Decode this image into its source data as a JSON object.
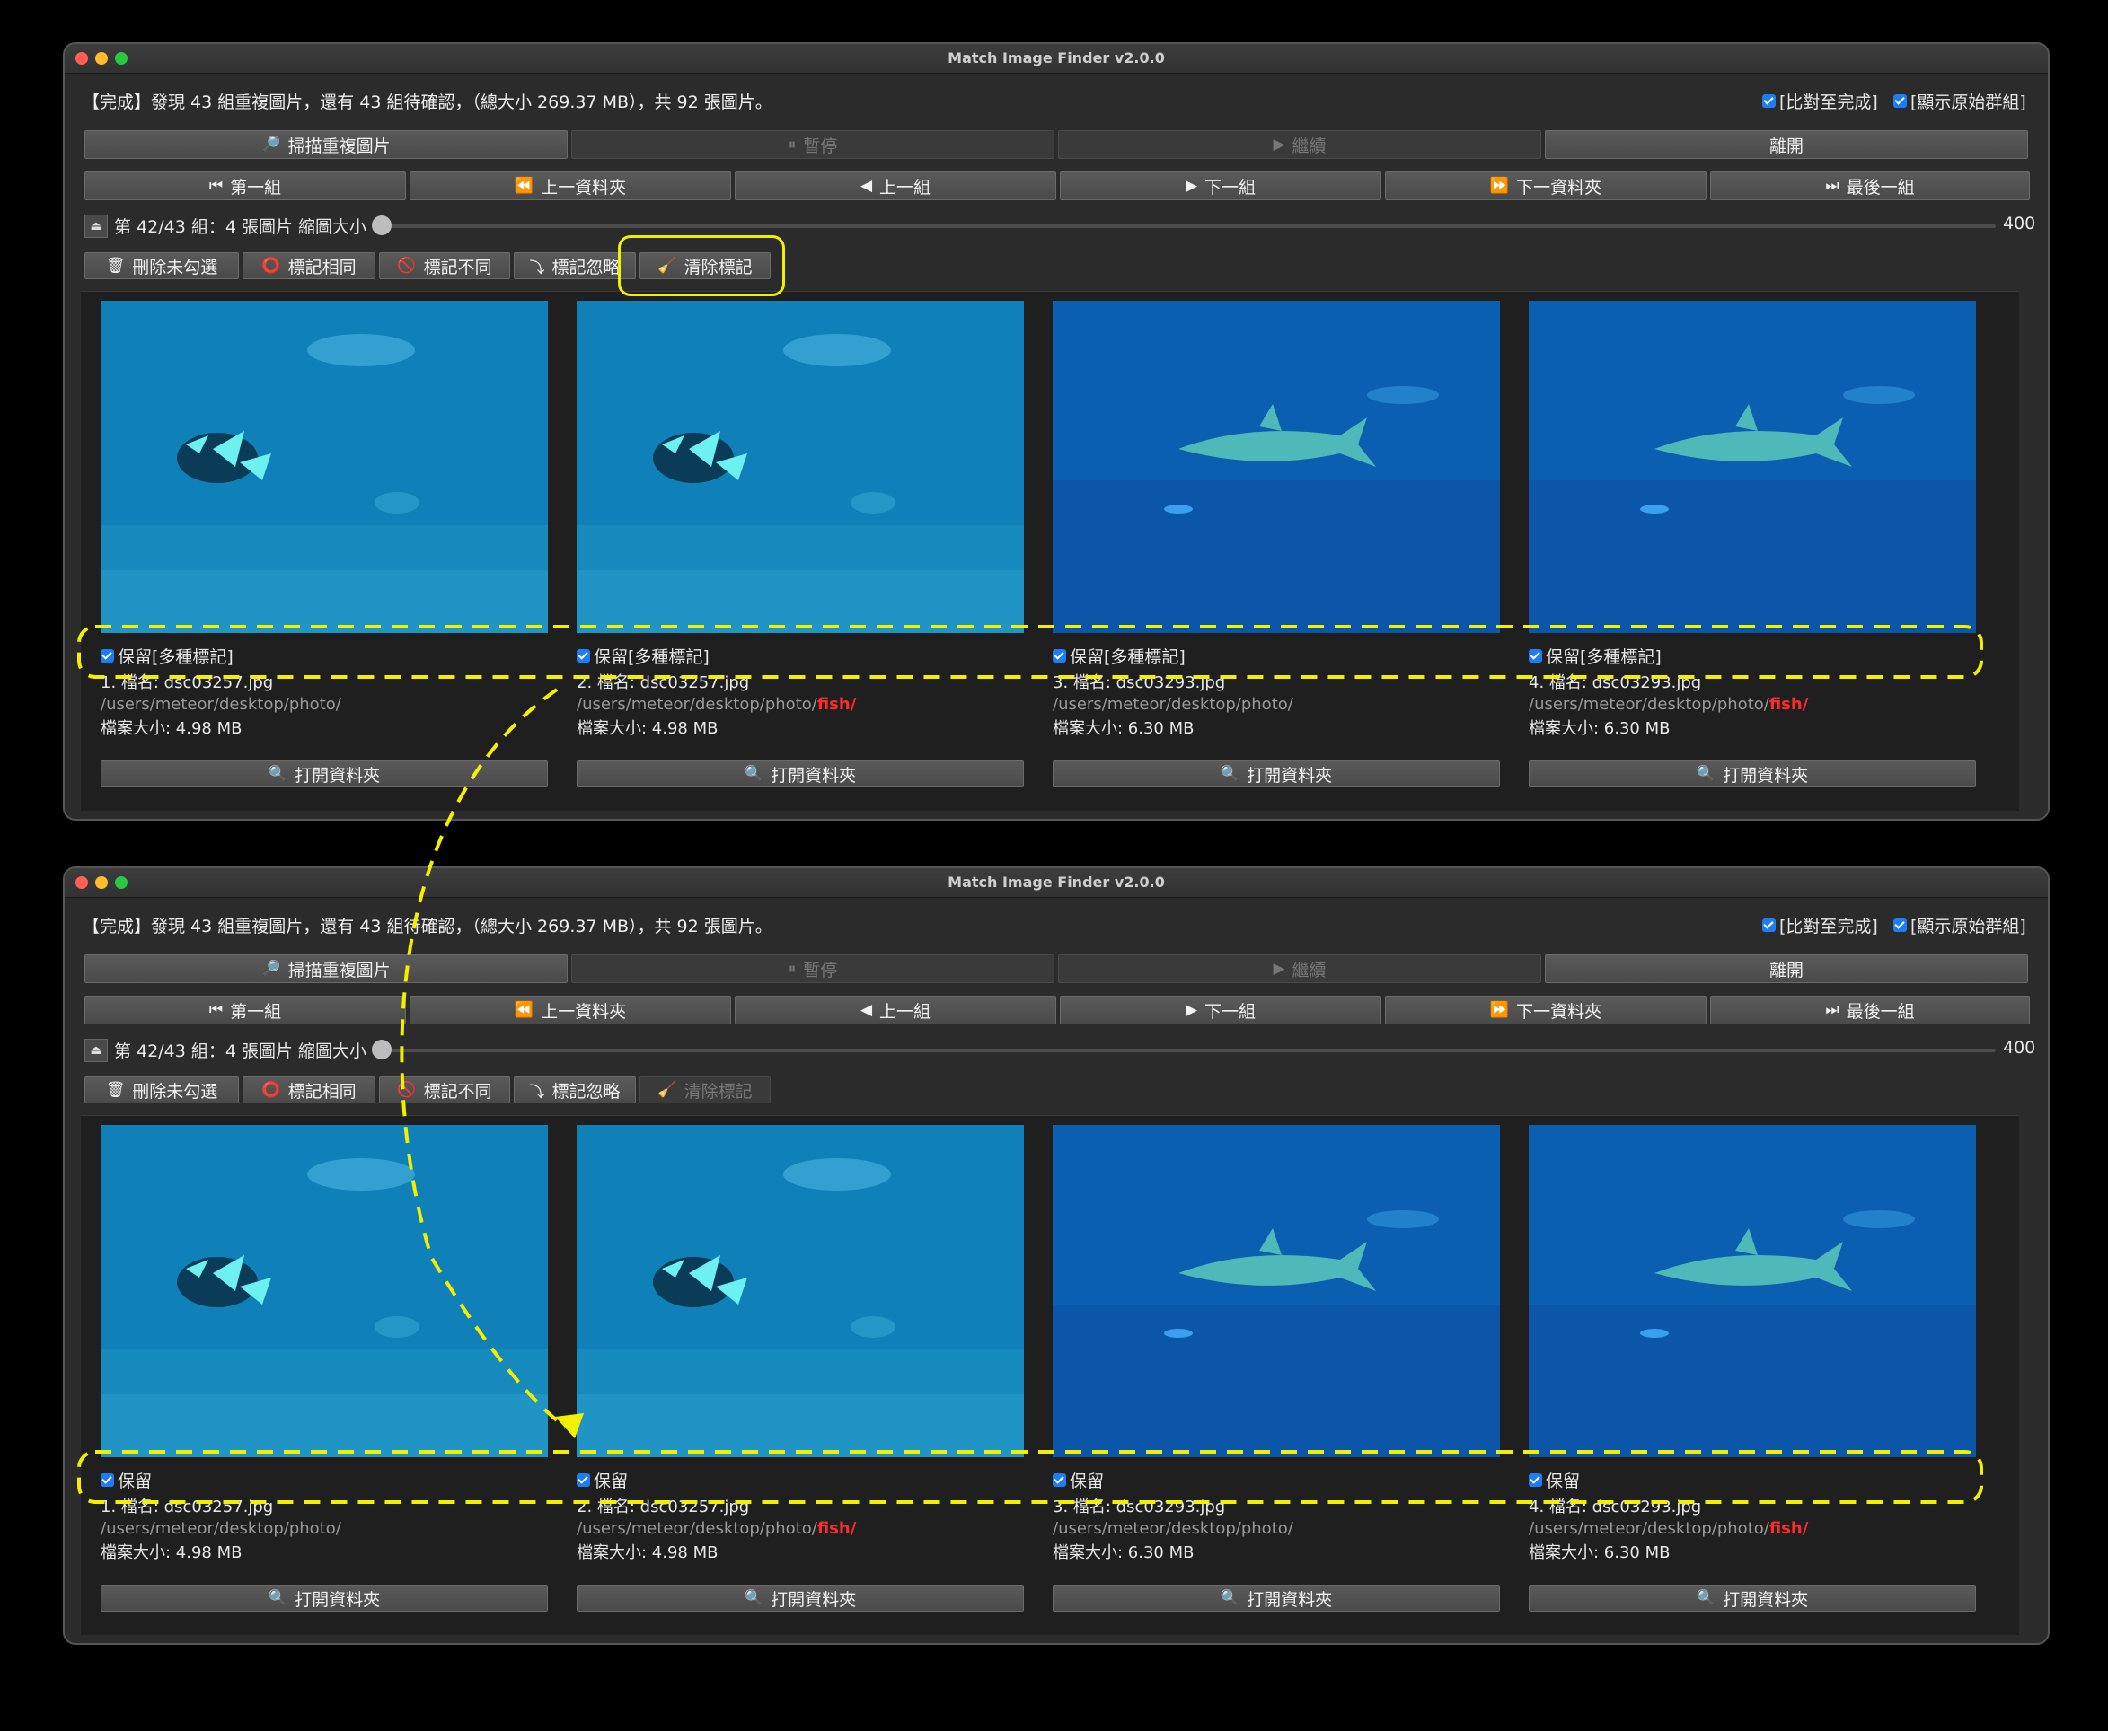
{
  "app": {
    "title": "Match Image Finder v2.0.0"
  },
  "status": "【完成】發現 43 組重複圖片，還有 43 組待確認，（總大小 269.37 MB），共 92 張圖片。",
  "options": {
    "compare_done": "[比對至完成]",
    "show_original": "[顯示原始群組]"
  },
  "toolbar": {
    "scan": "掃描重複圖片",
    "pause": "暫停",
    "resume": "繼續",
    "leave": "離開"
  },
  "nav": {
    "first": "第一組",
    "prev_folder": "上一資料夾",
    "prev": "上一組",
    "next": "下一組",
    "next_folder": "下一資料夾",
    "last": "最後一組"
  },
  "group_info": "第 42/43 組：4 張圖片 縮圖大小",
  "thumb_size": "400",
  "actions": {
    "delete_unchecked": "刪除未勾選",
    "mark_same": "標記相同",
    "mark_diff": "標記不同",
    "mark_ignore": "標記忽略",
    "clear_marks": "清除標記"
  },
  "open_folder": "打開資料夾",
  "images": [
    {
      "name": "1. 檔名: dsc03257.jpg",
      "path": "/users/meteor/desktop/photo/",
      "path_extra": "",
      "size": "檔案大小: 4.98 MB",
      "subject": "fish"
    },
    {
      "name": "2. 檔名: dsc03257.jpg",
      "path": "/users/meteor/desktop/photo/",
      "path_extra": "fish/",
      "size": "檔案大小: 4.98 MB",
      "subject": "fish"
    },
    {
      "name": "3. 檔名: dsc03293.jpg",
      "path": "/users/meteor/desktop/photo/",
      "path_extra": "",
      "size": "檔案大小: 6.30 MB",
      "subject": "shark"
    },
    {
      "name": "4. 檔名: dsc03293.jpg",
      "path": "/users/meteor/desktop/photo/",
      "path_extra": "fish/",
      "size": "檔案大小: 6.30 MB",
      "subject": "shark"
    }
  ],
  "windows": [
    {
      "keep_label": "保留[多種標記]",
      "clear_enabled": true
    },
    {
      "keep_label": "保留",
      "clear_enabled": false
    }
  ],
  "colors": {
    "highlight": "#f0f000",
    "checkbox": "#1d7df2",
    "path_red": "#ff2a2a"
  }
}
